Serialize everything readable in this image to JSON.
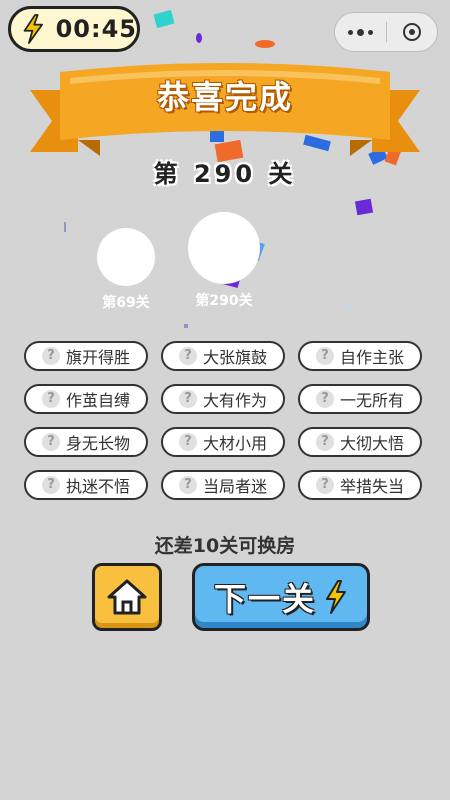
{
  "timer": {
    "time": "00:45",
    "icon": "lightning-icon"
  },
  "capsule": {
    "more_icon": "more-dots-icon",
    "close_icon": "target-close-icon"
  },
  "banner": {
    "title": "恭喜完成",
    "level": "第 290 关"
  },
  "rooms": [
    {
      "label": "第69关"
    },
    {
      "label": "第290关"
    }
  ],
  "idioms": [
    "旗开得胜",
    "大张旗鼓",
    "自作主张",
    "作茧自缚",
    "大有作为",
    "一无所有",
    "身无长物",
    "大材小用",
    "大彻大悟",
    "执迷不悟",
    "当局者迷",
    "举措失当"
  ],
  "remain_text": "还差10关可换房",
  "buttons": {
    "home_icon": "home-icon",
    "next_label": "下一关",
    "next_icon": "lightning-icon"
  },
  "colors": {
    "background": "#d4d4d4",
    "banner": "#f5a623",
    "next_button": "#5fb8f0",
    "home_button": "#f9c040",
    "bolt": "#f5c400"
  }
}
